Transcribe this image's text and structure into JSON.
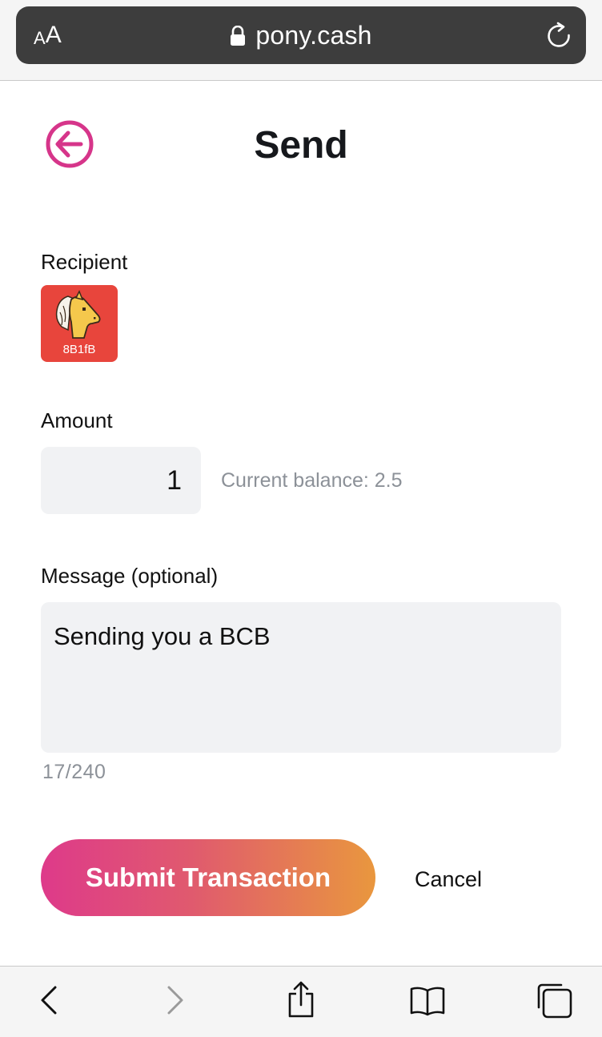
{
  "browser": {
    "text_size_small": "A",
    "text_size_large": "A",
    "url": "pony.cash",
    "icons": {
      "lock": "lock-icon",
      "reload": "reload-icon",
      "back": "chevron-left-icon",
      "forward": "chevron-right-icon",
      "share": "share-icon",
      "bookmarks": "book-icon",
      "tabs": "tabs-icon"
    }
  },
  "page": {
    "title": "Send",
    "back_icon": "circle-arrow-left-icon",
    "accent_color": "#d6358a"
  },
  "recipient": {
    "label": "Recipient",
    "avatar_icon": "pony-avatar-icon",
    "code": "8B1fB",
    "tile_color": "#e8453c"
  },
  "amount": {
    "label": "Amount",
    "value": "1",
    "balance_text": "Current balance: 2.5"
  },
  "message": {
    "label": "Message (optional)",
    "value": "Sending you a BCB",
    "counter": "17/240"
  },
  "actions": {
    "submit_label": "Submit Transaction",
    "cancel_label": "Cancel",
    "gradient": [
      "#de3a8a",
      "#e9973e"
    ]
  }
}
